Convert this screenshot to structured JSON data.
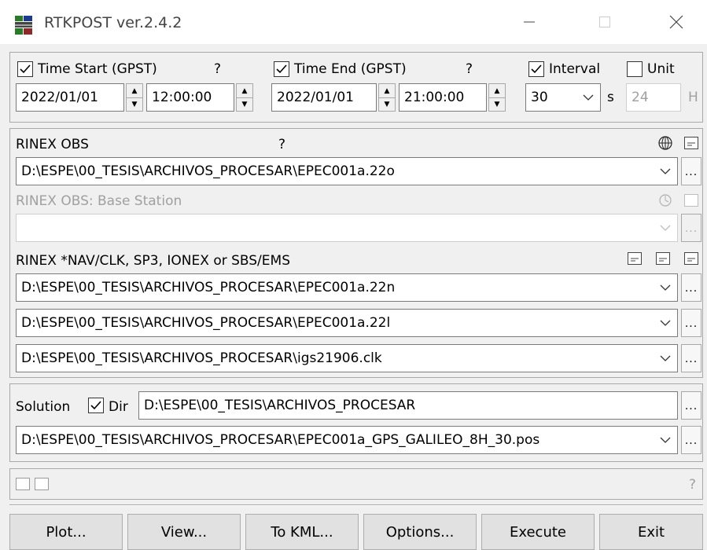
{
  "window": {
    "title": "RTKPOST ver.2.4.2"
  },
  "time": {
    "start_label": "Time Start (GPST)",
    "start_help": "?",
    "start_date": "2022/01/01",
    "start_time": "12:00:00",
    "end_label": "Time End (GPST)",
    "end_help": "?",
    "end_date": "2022/01/01",
    "end_time": "21:00:00",
    "interval_label": "Interval",
    "interval_value": "30",
    "interval_unit": "s",
    "unit_label": "Unit",
    "unit_value": "24",
    "unit_suffix": "H"
  },
  "rinex_obs": {
    "label": "RINEX OBS",
    "help": "?",
    "path": "D:\\ESPE\\00_TESIS\\ARCHIVOS_PROCESAR\\EPEC001a.22o",
    "base_label": "RINEX OBS: Base Station",
    "base_path": ""
  },
  "rinex_nav": {
    "label": "RINEX *NAV/CLK, SP3, IONEX or SBS/EMS",
    "files": [
      "D:\\ESPE\\00_TESIS\\ARCHIVOS_PROCESAR\\EPEC001a.22n",
      "D:\\ESPE\\00_TESIS\\ARCHIVOS_PROCESAR\\EPEC001a.22l",
      "D:\\ESPE\\00_TESIS\\ARCHIVOS_PROCESAR\\igs21906.clk"
    ]
  },
  "solution": {
    "label": "Solution",
    "dir_label": "Dir",
    "dir_path": "D:\\ESPE\\00_TESIS\\ARCHIVOS_PROCESAR",
    "file_path": "D:\\ESPE\\00_TESIS\\ARCHIVOS_PROCESAR\\EPEC001a_GPS_GALILEO_8H_30.pos"
  },
  "status": {
    "help": "?"
  },
  "buttons": {
    "plot": "Plot...",
    "view": "View...",
    "to_kml": "To KML...",
    "options": "Options...",
    "execute": "Execute",
    "exit": "Exit"
  },
  "ellipsis": "...",
  "colors": {
    "accent": "#0078d7",
    "disabled_text": "#a0a0a0"
  }
}
